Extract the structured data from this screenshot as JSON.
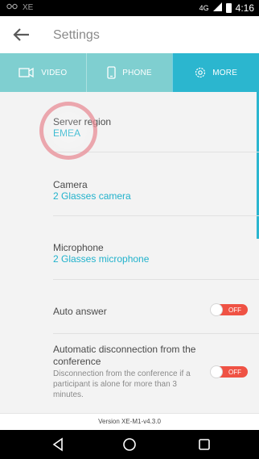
{
  "status_bar": {
    "left_label": "XE",
    "network": "4G",
    "time": "4:16"
  },
  "app_bar": {
    "title": "Settings"
  },
  "tabs": [
    {
      "label": "VIDEO",
      "icon": "video-camera-icon",
      "active": false
    },
    {
      "label": "PHONE",
      "icon": "phone-icon",
      "active": false
    },
    {
      "label": "MORE",
      "icon": "gear-icon",
      "active": true
    }
  ],
  "settings": {
    "server_region": {
      "label": "Server region",
      "value": "EMEA"
    },
    "camera": {
      "label": "Camera",
      "value": "2 Glasses camera"
    },
    "microphone": {
      "label": "Microphone",
      "value": "2 Glasses microphone"
    },
    "auto_answer": {
      "label": "Auto answer",
      "toggle_label": "OFF"
    },
    "auto_disconnect": {
      "label": "Automatic disconnection from the conference",
      "description": "Disconnection from the conference if a participant is alone for more than 3 minutes.",
      "toggle_label": "OFF"
    }
  },
  "version": "Version XE-M1-v4.3.0",
  "colors": {
    "accent": "#2bb6cf",
    "tab_inactive": "#7fcfd0",
    "toggle_off": "#ef5244",
    "highlight": "#e88c96"
  },
  "nav_bar": {
    "back": "triangle-back-icon",
    "home": "circle-home-icon",
    "recents": "square-recents-icon"
  }
}
